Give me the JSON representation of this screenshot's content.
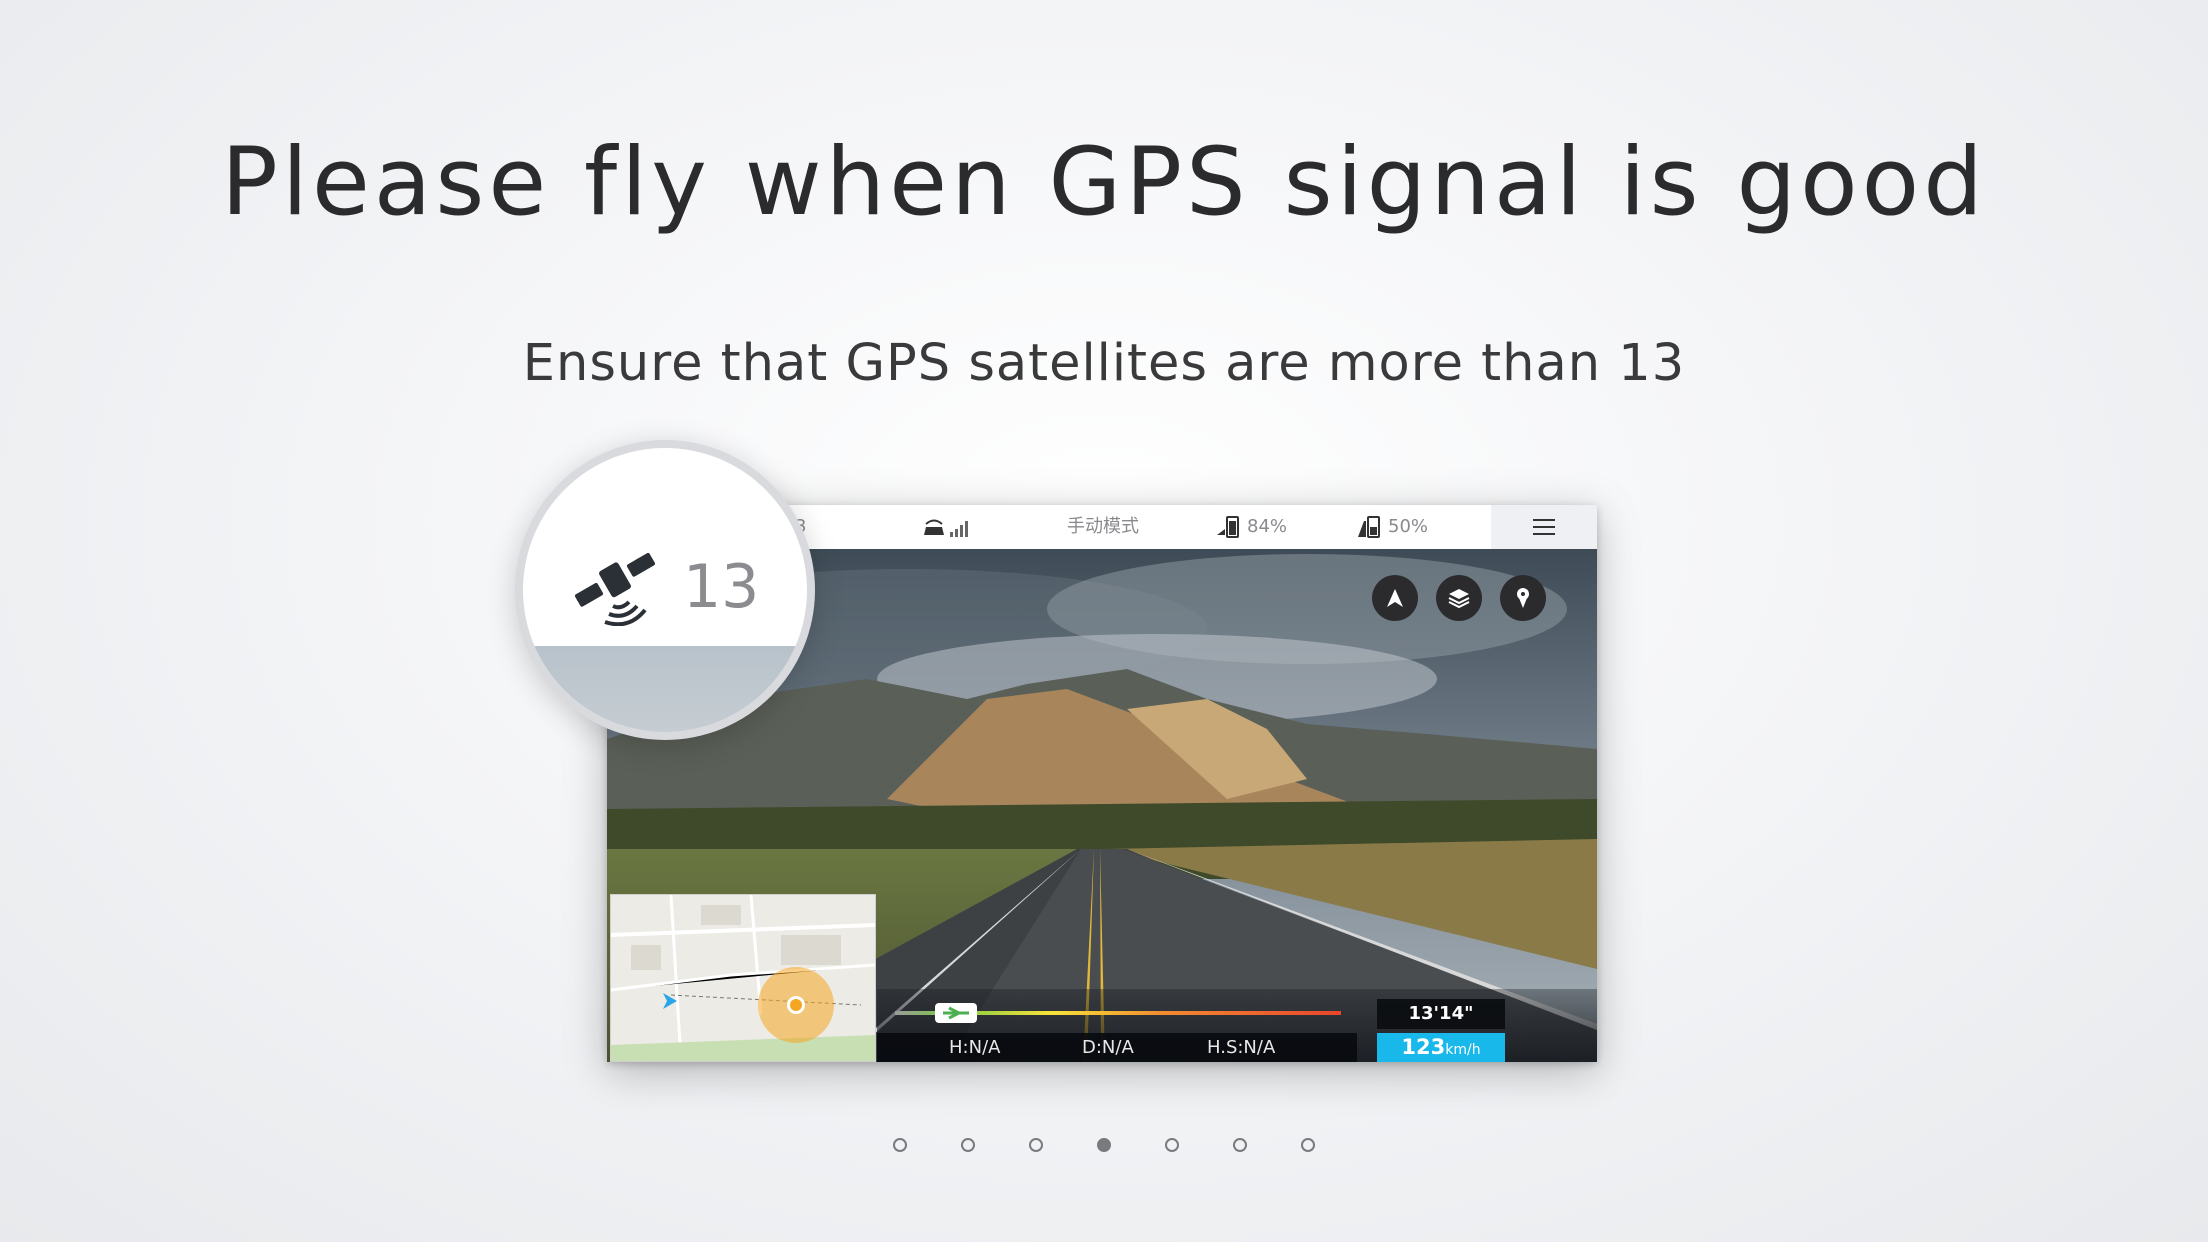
{
  "headline": "Please fly when GPS signal is good",
  "subheadline": "Ensure that GPS satellites are more than 13",
  "status_bar": {
    "mode": "手动模式",
    "phone_battery": "84%",
    "drone_battery": "50%",
    "satellite_fragment": "3"
  },
  "magnifier": {
    "satellite_count": "13"
  },
  "telemetry": {
    "height": "H:N/A",
    "distance": "D:N/A",
    "horizontal_speed": "H.S:N/A",
    "flight_time": "13'14\"",
    "speed_value": "123",
    "speed_unit": "km/h"
  },
  "pager": {
    "total": 7,
    "active_index": 3
  },
  "colors": {
    "accent": "#18b8ea",
    "home_marker": "#f5a623"
  }
}
